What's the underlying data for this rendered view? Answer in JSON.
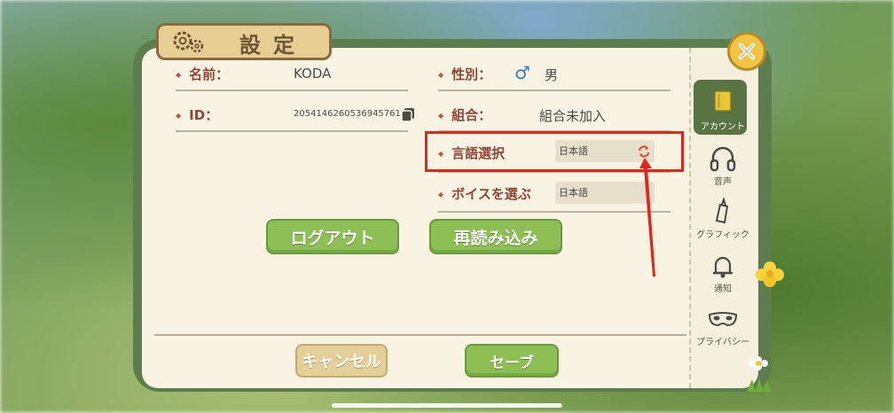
{
  "header": {
    "title": "設定"
  },
  "account": {
    "name_label": "名前：",
    "name_value": "KODA",
    "id_label": "ID：",
    "id_value": "20541462605369457​61",
    "gender_label": "性別：",
    "gender_symbol": "♂",
    "gender_value": "男",
    "union_label": "組合：",
    "union_value": "組合未加入",
    "language_label": "言語選択",
    "language_value": "日本語",
    "voice_label": "ボイスを選ぶ",
    "voice_value": "日本語"
  },
  "buttons": {
    "logout": "ログアウト",
    "reload": "再読み込み",
    "cancel": "キャンセル",
    "save": "セーブ"
  },
  "sidebar": {
    "items": [
      {
        "label": "アカウント",
        "icon": "book-icon"
      },
      {
        "label": "音声",
        "icon": "headphones-icon"
      },
      {
        "label": "グラフィック",
        "icon": "paintbrush-icon"
      },
      {
        "label": "通知",
        "icon": "bell-icon"
      },
      {
        "label": "プライバシー",
        "icon": "mask-icon"
      }
    ]
  },
  "colors": {
    "highlight": "#e1261c",
    "accent_green": "#8dbf55",
    "label_red": "#8f4637"
  }
}
